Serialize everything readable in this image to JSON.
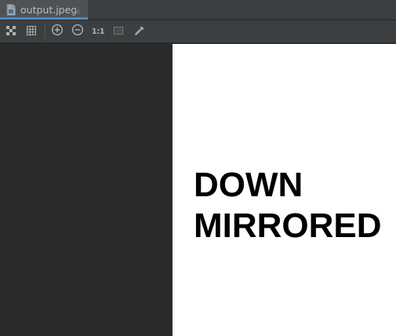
{
  "tab": {
    "file_icon": "file-image-icon",
    "label": "output.jpeg",
    "close_icon": "close-icon"
  },
  "toolbar": {
    "buttons": [
      {
        "name": "fit-to-window",
        "icon": "fit-window-icon"
      },
      {
        "name": "toggle-grid",
        "icon": "grid-icon"
      },
      {
        "name": "zoom-in",
        "icon": "zoom-in-icon"
      },
      {
        "name": "zoom-out",
        "icon": "zoom-out-icon"
      },
      {
        "name": "actual-size",
        "label": "1:1"
      },
      {
        "name": "toggle-background",
        "icon": "background-icon"
      },
      {
        "name": "color-picker",
        "icon": "eyedropper-icon"
      }
    ],
    "actual_size_label": "1:1"
  },
  "image": {
    "line1": "DOWN",
    "line2": "MIRRORED",
    "background": "#ffffff",
    "text_color": "#000000"
  },
  "colors": {
    "editor_background": "#2b2b2b",
    "toolbar_background": "#3c3f41",
    "active_tab_underline": "#4a88c7"
  }
}
